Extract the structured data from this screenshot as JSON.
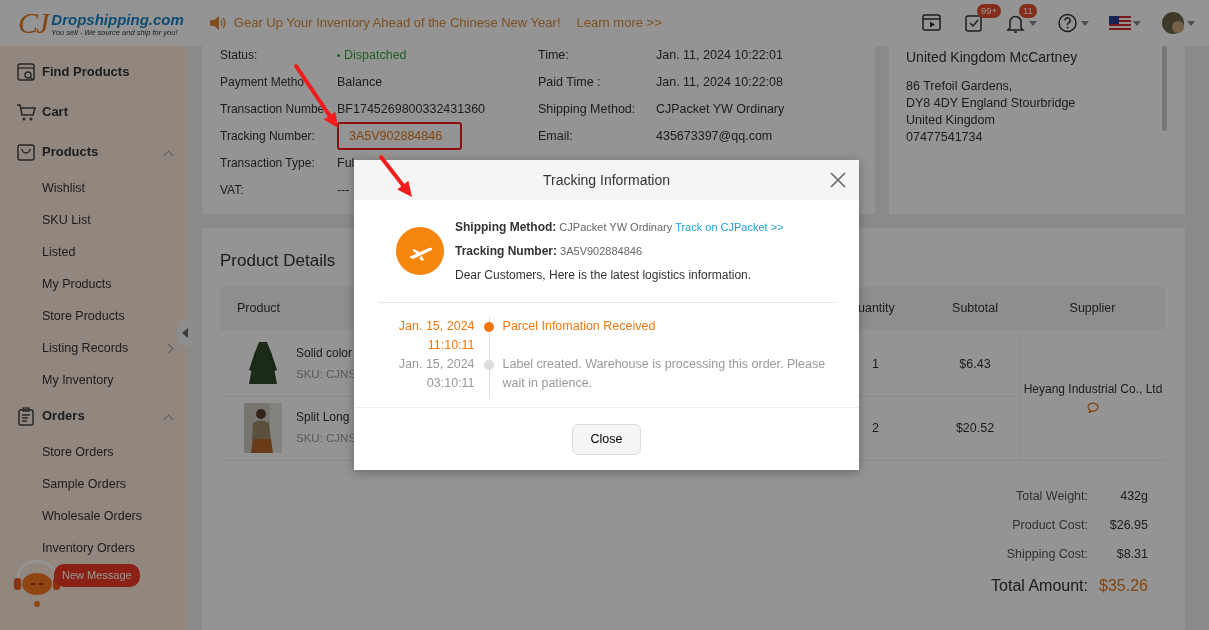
{
  "header": {
    "logo": {
      "mark": "CJ",
      "name": "Dropshipping.com",
      "tagline": "You sell - We source and ship for you!"
    },
    "announcement": {
      "text": "Gear Up Your Inventory Ahead of the Chinese New Year!",
      "link": "Learn more >>"
    },
    "tools": [
      {
        "kind": "video"
      },
      {
        "kind": "tasks",
        "badge": "99+"
      },
      {
        "kind": "bell",
        "badge": "11",
        "dropdown": true
      },
      {
        "kind": "help",
        "dropdown": true
      },
      {
        "kind": "flag",
        "dropdown": true
      },
      {
        "kind": "avatar",
        "dropdown": true
      }
    ]
  },
  "sidebar": {
    "items": [
      {
        "label": "Find Products"
      },
      {
        "label": "Cart"
      },
      {
        "label": "Products",
        "expanded": true,
        "children": [
          {
            "label": "Wishlist"
          },
          {
            "label": "SKU List"
          },
          {
            "label": "Listed"
          },
          {
            "label": "My Products"
          },
          {
            "label": "Store Products"
          },
          {
            "label": "Listing Records",
            "submenu": true
          },
          {
            "label": "My Inventory"
          }
        ]
      },
      {
        "label": "Orders",
        "expanded": true,
        "children": [
          {
            "label": "Store Orders"
          },
          {
            "label": "Sample Orders"
          },
          {
            "label": "Wholesale Orders"
          },
          {
            "label": "Inventory Orders"
          }
        ]
      }
    ]
  },
  "order_info": {
    "left": [
      {
        "label": "Status:",
        "value": "Dispatched",
        "kind": "status"
      },
      {
        "label": "Payment Metho",
        "value": "Balance",
        "kind": "text"
      },
      {
        "label": "Transaction Numbe",
        "value": "BF1745269800332431360",
        "kind": "text"
      },
      {
        "label": "Tracking Number:",
        "value": "3A5V902884846",
        "kind": "link",
        "highlighted": true
      },
      {
        "label": "Transaction Type:",
        "value": "Ful",
        "kind": "text"
      },
      {
        "label": "VAT:",
        "value": "---",
        "kind": "text"
      }
    ],
    "right": [
      {
        "label": "Time:",
        "value": "Jan. 11, 2024 10:22:01"
      },
      {
        "label": "Paid Time :",
        "value": "Jan. 11, 2024 10:22:08"
      },
      {
        "label": "Shipping Method:",
        "value": "CJPacket YW Ordinary"
      },
      {
        "label": "Email:",
        "value": "435673397@qq.com"
      }
    ]
  },
  "address": {
    "name": "United Kingdom McCartney",
    "lines": [
      "86 Trefoil Gardens,",
      "DY8 4DY England Stourbridge",
      "United Kingdom",
      "07477541734"
    ]
  },
  "product_details": {
    "title": "Product Details",
    "columns": [
      "Product",
      "uantity",
      "Subtotal",
      "Supplier"
    ],
    "rows": [
      {
        "name": "Solid color",
        "sku": "SKU: CJNS",
        "quantity": "1",
        "subtotal": "$6.43",
        "kind": "dress"
      },
      {
        "name": "Split Long",
        "sku": "SKU: CJNS",
        "quantity": "2",
        "subtotal": "$20.52"
      }
    ],
    "supplier": "Heyang Industrial Co., Ltd",
    "summary": [
      {
        "label": "Total Weight:",
        "value": "432g"
      },
      {
        "label": "Product Cost:",
        "value": "$26.95"
      },
      {
        "label": "Shipping Cost:",
        "value": "$8.31"
      }
    ],
    "total": {
      "label": "Total Amount:",
      "value": "$35.26"
    }
  },
  "chat": {
    "badge": "New Message"
  },
  "modal": {
    "title": "Tracking Information",
    "fields": [
      {
        "label": "Shipping Method:",
        "value": "CJPacket YW Ordinary",
        "link": "Track on CJPacket >>"
      },
      {
        "label": "Tracking Number:",
        "value": "3A5V902884846"
      }
    ],
    "message": "Dear Customers, Here is the latest logistics information.",
    "events": [
      {
        "date": "Jan. 15, 2024",
        "time": "11:10:11",
        "text": "Parcel Infomation Received",
        "current": true
      },
      {
        "date": "Jan. 15, 2024",
        "time": "03:10:11",
        "text": "Label created. Warehouse is processing this order. Please wait in patience.",
        "current": false
      }
    ],
    "button": "Close"
  }
}
